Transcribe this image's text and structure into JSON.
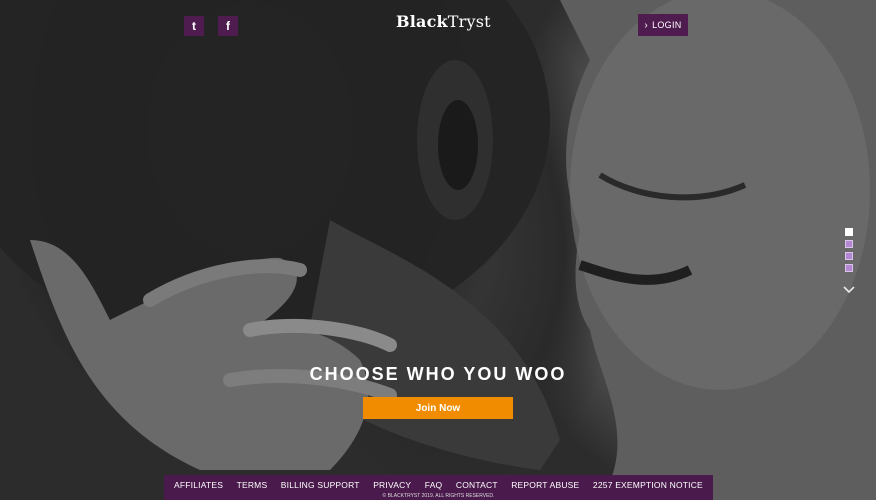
{
  "brand": {
    "logo_bold": "Black",
    "logo_light": "Tryst"
  },
  "header": {
    "twitter_glyph": "t",
    "facebook_glyph": "f",
    "login_label": "LOGIN"
  },
  "hero": {
    "headline": "CHOOSE WHO YOU WOO",
    "cta_label": "Join Now",
    "slides": [
      {
        "active": true
      },
      {
        "active": false
      },
      {
        "active": false
      },
      {
        "active": false
      }
    ]
  },
  "footer": {
    "links": [
      "AFFILIATES",
      "TERMS",
      "BILLING SUPPORT",
      "PRIVACY",
      "FAQ",
      "CONTACT",
      "REPORT ABUSE",
      "2257 EXEMPTION NOTICE"
    ],
    "copyright": "© BLACKTRYST 2019. ALL RIGHTS RESERVED."
  },
  "colors": {
    "brand_purple": "#4f1c4f",
    "cta_orange": "#f18c00",
    "slide_dot": "#b387d1"
  }
}
